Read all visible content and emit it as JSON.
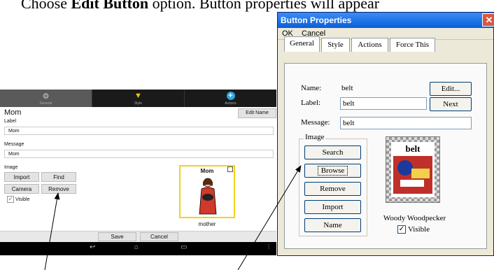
{
  "caption": {
    "prefix": "Choose ",
    "bold": "Edit Button",
    "suffix": " option. Button properties will appear"
  },
  "android": {
    "tabs": [
      {
        "label": "General"
      },
      {
        "label": "Style"
      },
      {
        "label": "Actions"
      }
    ],
    "title": "Mom",
    "edit_name_button": "Edit Name",
    "label_caption": "Label",
    "label_value": "Mom",
    "message_caption": "Message",
    "message_value": "Mom",
    "image_caption": "Image",
    "buttons": {
      "import": "Import",
      "find": "Find",
      "camera": "Camera",
      "remove": "Remove"
    },
    "visible_label": "Visible",
    "card_title": "Mom",
    "card_caption": "mother",
    "save_button": "Save",
    "cancel_button": "Cancel"
  },
  "dialog": {
    "title": "Button Properties",
    "close_glyph": "✕",
    "menu": {
      "ok": "OK",
      "cancel": "Cancel"
    },
    "tabs": [
      "General",
      "Style",
      "Actions",
      "Force This"
    ],
    "name_label": "Name:",
    "name_value": "belt",
    "edit_button": "Edit...",
    "label_label": "Label:",
    "label_value": "belt",
    "next_button": "Next",
    "message_label": "Message:",
    "message_value": "belt",
    "image_group": "Image",
    "image_buttons": {
      "search": "Search",
      "browse": "Browse",
      "remove": "Remove",
      "import": "Import",
      "name": "Name"
    },
    "picture_word": "belt",
    "picture_name": "Woody Woodpecker",
    "visible_label": "Visible"
  },
  "colors": {
    "android_bar": "#1a1a1a",
    "card_border": "#f1d21b",
    "xp_title": "#0a5fd8",
    "xp_close": "#d9573f"
  },
  "icons": {
    "general_tab": "gear-icon",
    "style_tab": "shirt-icon",
    "actions_tab": "plus-icon"
  }
}
